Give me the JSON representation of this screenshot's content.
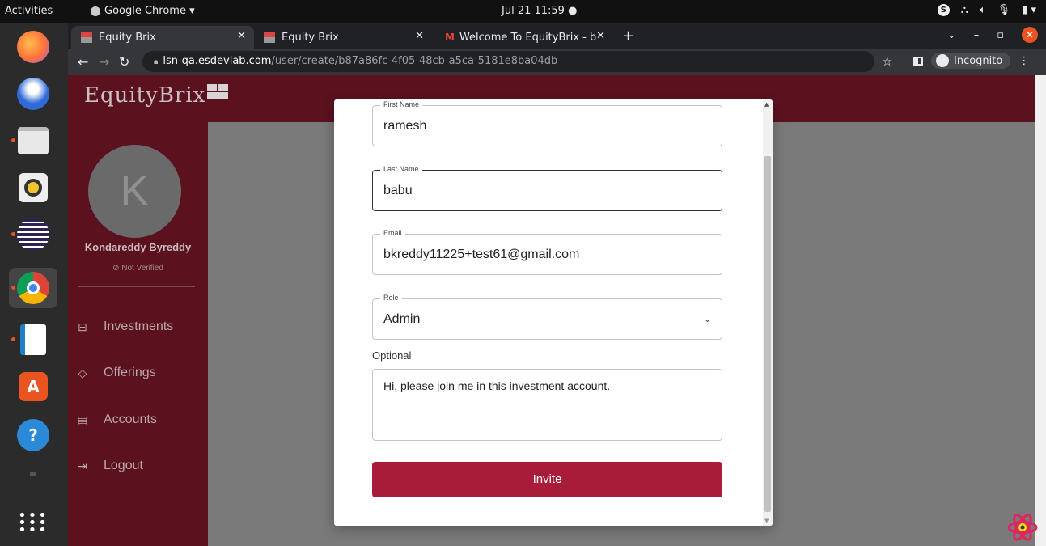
{
  "os": {
    "activities": "Activities",
    "app_menu": "Google Chrome ▾",
    "clock": "Jul 21  11:59  ●"
  },
  "browser": {
    "tabs": [
      {
        "label": "Equity Brix"
      },
      {
        "label": "Equity Brix"
      },
      {
        "label": "Welcome To EquityBrix - b"
      }
    ],
    "url_host": "lsn-qa.esdevlab.com",
    "url_path": "/user/create/b87a86fc-4f05-48cb-a5ca-5181e8ba04db",
    "incognito_label": "Incognito"
  },
  "app": {
    "logo": "EquityBrix",
    "user": {
      "avatar_letter": "K",
      "name": "Kondareddy Byreddy",
      "status": "Not Verified"
    },
    "nav": [
      {
        "label": "Investments",
        "icon": "investments-icon"
      },
      {
        "label": "Offerings",
        "icon": "tag-icon"
      },
      {
        "label": "Accounts",
        "icon": "accounts-icon"
      },
      {
        "label": "Logout",
        "icon": "logout-icon"
      }
    ]
  },
  "modal": {
    "first_name": {
      "label": "First Name",
      "value": "ramesh"
    },
    "last_name": {
      "label": "Last Name",
      "value": "babu"
    },
    "email": {
      "label": "Email",
      "value": "bkreddy11225+test61@gmail.com"
    },
    "role": {
      "label": "Role",
      "value": "Admin"
    },
    "optional_label": "Optional",
    "message": "Hi, please join me in this investment account.",
    "invite_button": "Invite"
  },
  "colors": {
    "brand": "#5c111f",
    "button": "#a71d39"
  }
}
